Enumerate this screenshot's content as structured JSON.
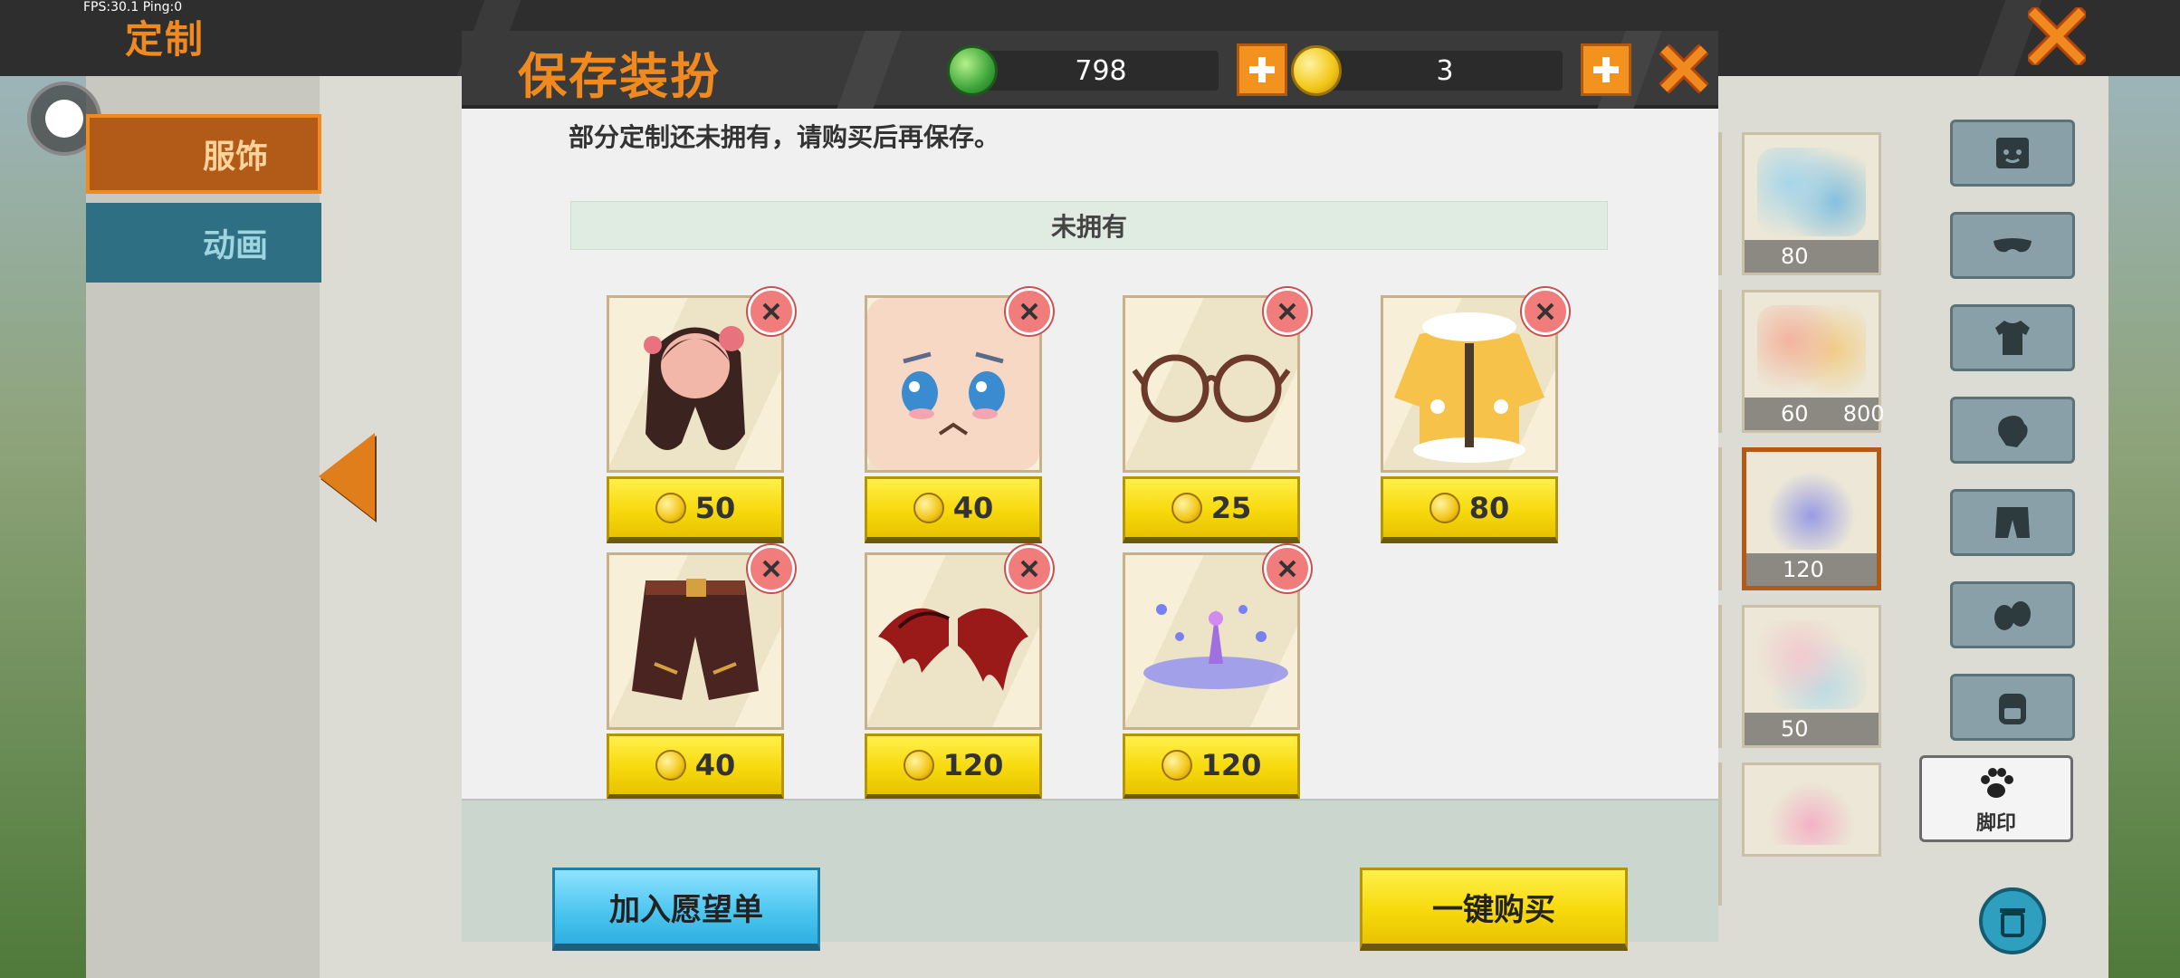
{
  "status": {
    "fps_text": "FPS:30.1  Ping:0"
  },
  "background": {
    "title": "定制",
    "tabs": [
      {
        "label": "服饰",
        "active": true
      },
      {
        "label": "动画",
        "active": false
      }
    ],
    "shop_items": [
      {
        "price": "80"
      },
      {
        "price": "60",
        "price2": "800"
      },
      {
        "price": "120"
      },
      {
        "price": "50"
      }
    ],
    "categories": [
      {
        "icon": "face-icon"
      },
      {
        "icon": "mask-icon"
      },
      {
        "icon": "shirt-icon"
      },
      {
        "icon": "glove-icon"
      },
      {
        "icon": "pants-icon"
      },
      {
        "icon": "shoes-icon"
      },
      {
        "icon": "backpack-icon"
      },
      {
        "icon": "paw-icon",
        "label": "脚印",
        "active": true
      }
    ]
  },
  "modal": {
    "title": "保存装扮",
    "gems": "798",
    "coins": "3",
    "notice": "部分定制还未拥有，请购买后再保存。",
    "section_title": "未拥有",
    "items": [
      {
        "name": "hair",
        "price": "50"
      },
      {
        "name": "face",
        "price": "40"
      },
      {
        "name": "glasses",
        "price": "25"
      },
      {
        "name": "jacket",
        "price": "80"
      },
      {
        "name": "shorts",
        "price": "40"
      },
      {
        "name": "wings",
        "price": "120"
      },
      {
        "name": "footprint-effect",
        "price": "120"
      }
    ],
    "wishlist_label": "加入愿望单",
    "buy_all_label": "一键购买"
  },
  "colors": {
    "accent_orange": "#f08a1e",
    "price_yellow": "#f7d90c",
    "wish_blue": "#49c4ef",
    "remove_red": "#f07c7c"
  }
}
